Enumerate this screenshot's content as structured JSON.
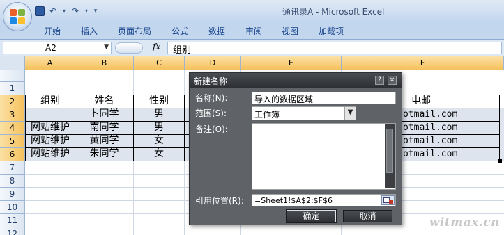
{
  "window": {
    "title": "通讯录A - Microsoft Excel"
  },
  "ribbon": {
    "tabs": [
      "开始",
      "插入",
      "页面布局",
      "公式",
      "数据",
      "审阅",
      "视图",
      "加载项"
    ]
  },
  "formula_bar": {
    "name_box": "A2",
    "fx": "fx",
    "formula": "组别"
  },
  "sheet": {
    "columns": [
      "A",
      "B",
      "C",
      "D",
      "E",
      "F"
    ],
    "rows": [
      "1",
      "2",
      "3",
      "4",
      "5",
      "6",
      "7",
      "8",
      "9",
      "10",
      "11",
      "12"
    ],
    "header_row": {
      "a": "组别",
      "b": "姓名",
      "c": "性别",
      "f": "电邮"
    },
    "data": [
      {
        "a": "",
        "b": "卜同学",
        "c": "男",
        "f": "otmail.com"
      },
      {
        "a": "网站维护",
        "b": "南同学",
        "c": "男",
        "f": "otmail.com"
      },
      {
        "a": "网站维护",
        "b": "黄同学",
        "c": "女",
        "f": "otmail.com"
      },
      {
        "a": "网站维护",
        "b": "朱同学",
        "c": "女",
        "f": "otmail.com"
      }
    ]
  },
  "dialog": {
    "title": "新建名称",
    "help_icon": "?",
    "close_icon": "×",
    "name_label": "名称(N):",
    "name_value": "导入的数据区域",
    "scope_label": "范围(S):",
    "scope_value": "工作簿",
    "comment_label": "备注(O):",
    "comment_value": "",
    "refers_label": "引用位置(R):",
    "refers_value": "=Sheet1!$A$2:$F$6",
    "ok_label": "确定",
    "cancel_label": "取消"
  },
  "watermark": "witmax.cn"
}
